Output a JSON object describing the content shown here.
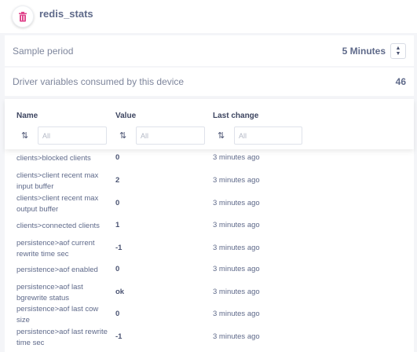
{
  "device": {
    "title": "redis_stats",
    "icon": "trash-icon",
    "icon_color": "#e0478d"
  },
  "sample_period": {
    "label": "Sample period",
    "value": "5 Minutes"
  },
  "driver_variables": {
    "label": "Driver variables consumed by this device",
    "count": "46"
  },
  "table": {
    "columns": [
      {
        "label": "Name",
        "placeholder": "All"
      },
      {
        "label": "Value",
        "placeholder": "All"
      },
      {
        "label": "Last change",
        "placeholder": "All"
      }
    ],
    "rows": [
      {
        "name": "clients>blocked clients",
        "value": "0",
        "last_change": "3 minutes ago"
      },
      {
        "name": "clients>client recent max input buffer",
        "value": "2",
        "last_change": "3 minutes ago"
      },
      {
        "name": "clients>client recent max output buffer",
        "value": "0",
        "last_change": "3 minutes ago"
      },
      {
        "name": "clients>connected clients",
        "value": "1",
        "last_change": "3 minutes ago"
      },
      {
        "name": "persistence>aof current rewrite time sec",
        "value": "-1",
        "last_change": "3 minutes ago"
      },
      {
        "name": "persistence>aof enabled",
        "value": "0",
        "last_change": "3 minutes ago"
      },
      {
        "name": "persistence>aof last bgrewrite status",
        "value": "ok",
        "last_change": "3 minutes ago"
      },
      {
        "name": "persistence>aof last cow size",
        "value": "0",
        "last_change": "3 minutes ago"
      },
      {
        "name": "persistence>aof last rewrite time sec",
        "value": "-1",
        "last_change": "3 minutes ago"
      }
    ]
  }
}
